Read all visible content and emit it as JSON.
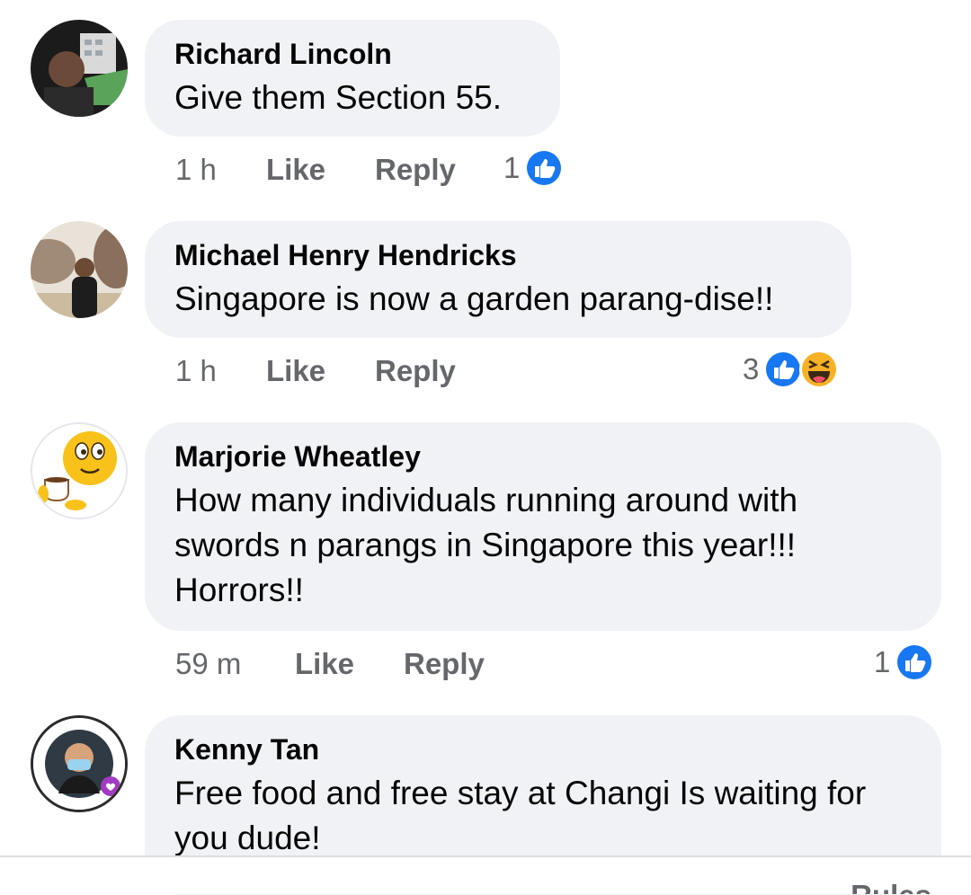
{
  "comments": [
    {
      "author": "Richard Lincoln",
      "text": "Give them Section 55.",
      "time": "1 h",
      "like_label": "Like",
      "reply_label": "Reply",
      "reaction_count": "1",
      "reactions": [
        "like-icon"
      ]
    },
    {
      "author": "Michael Henry Hendricks",
      "text": "Singapore is now a garden parang-dise!!",
      "time": "1 h",
      "like_label": "Like",
      "reply_label": "Reply",
      "reaction_count": "3",
      "reactions": [
        "like-icon",
        "haha-icon"
      ]
    },
    {
      "author": "Marjorie Wheatley",
      "text": "How many individuals running around with swords n parangs in Singapore this year!!! Horrors!!",
      "time": "59 m",
      "like_label": "Like",
      "reply_label": "Reply",
      "reaction_count": "1",
      "reactions": [
        "like-icon"
      ]
    },
    {
      "author": "Kenny Tan",
      "text": "Free food and free stay at Changi Is waiting for you dude!"
    }
  ],
  "footer": {
    "rules_label": "Rules"
  },
  "colors": {
    "bubble_bg": "#f0f2f5",
    "meta_text": "#65676b",
    "like_blue": "#1877f2"
  }
}
